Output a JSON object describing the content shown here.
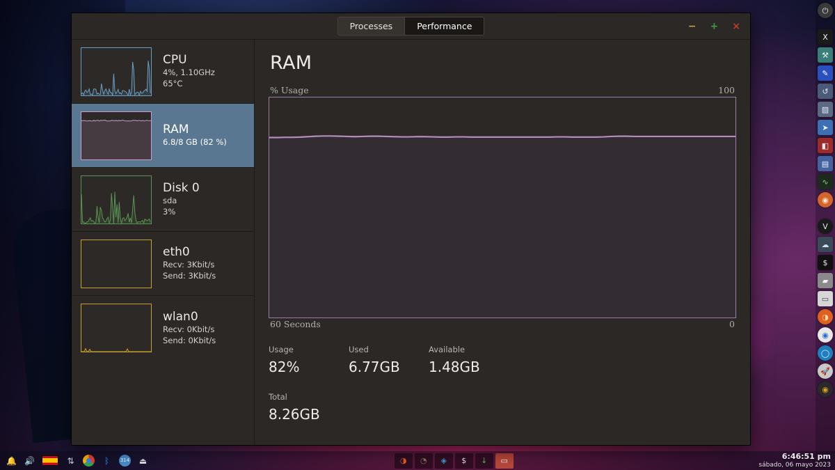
{
  "window": {
    "tabs": [
      {
        "label": "Processes",
        "active": false
      },
      {
        "label": "Performance",
        "active": true
      }
    ],
    "controls": {
      "minimize": "−",
      "maximize": "+",
      "close": "×"
    }
  },
  "sidebar": {
    "items": [
      {
        "id": "cpu",
        "title": "CPU",
        "lines": [
          "4%, 1.10GHz",
          "65°C"
        ],
        "color": "#6a9fc4",
        "selected": false,
        "graph_kind": "spiky-low"
      },
      {
        "id": "ram",
        "title": "RAM",
        "lines": [
          "6.8/8 GB (82 %)"
        ],
        "color": "#c79dd4",
        "selected": true,
        "graph_kind": "flat-high"
      },
      {
        "id": "disk0",
        "title": "Disk 0",
        "lines": [
          "sda",
          "3%"
        ],
        "color": "#5a9455",
        "selected": false,
        "graph_kind": "spiky-low"
      },
      {
        "id": "eth0",
        "title": "eth0",
        "lines": [
          "Recv: 3Kbit/s",
          "Send: 3Kbit/s"
        ],
        "color": "#c8a22a",
        "selected": false,
        "graph_kind": "empty"
      },
      {
        "id": "wlan0",
        "title": "wlan0",
        "lines": [
          "Recv: 0Kbit/s",
          "Send: 0Kbit/s"
        ],
        "color": "#c8a22a",
        "selected": false,
        "graph_kind": "near-zero"
      }
    ]
  },
  "main": {
    "title": "RAM",
    "axis": {
      "y_label": "% Usage",
      "y_max": "100",
      "y_min": "0",
      "x_label": "60 Seconds"
    },
    "stats": [
      {
        "label": "Usage",
        "value": "82%"
      },
      {
        "label": "Used",
        "value": "6.77GB"
      },
      {
        "label": "Available",
        "value": "1.48GB"
      }
    ],
    "total": {
      "label": "Total",
      "value": "8.26GB"
    },
    "accent_color": "#9b7ba8"
  },
  "chart_data": {
    "type": "area",
    "title": "RAM % Usage",
    "ylabel": "% Usage",
    "xlabel": "60 Seconds",
    "ylim": [
      0,
      100
    ],
    "xlim": [
      60,
      0
    ],
    "grid": false,
    "legend": false,
    "line_color": "#b48cc0",
    "fill_color": "#332c33",
    "series": [
      {
        "name": "RAM % Usage",
        "values": [
          81.8,
          81.8,
          81.9,
          81.9,
          82.0,
          82.2,
          82.4,
          82.5,
          82.5,
          82.4,
          82.3,
          82.2,
          82.3,
          82.4,
          82.4,
          82.3,
          82.2,
          82.1,
          82.1,
          82.2,
          82.2,
          82.1,
          82.0,
          82.0,
          82.1,
          82.1,
          82.0,
          82.0,
          82.0,
          82.0,
          82.0,
          82.0,
          82.0,
          82.0,
          82.0,
          82.0,
          82.0,
          82.1,
          82.1,
          82.0,
          82.0,
          82.0,
          82.0,
          82.1,
          82.3,
          82.4,
          82.4,
          82.3,
          82.3,
          82.3,
          82.3,
          82.3,
          82.3,
          82.3,
          82.3,
          82.3,
          82.3,
          82.3,
          82.3,
          82.3,
          82.3
        ]
      }
    ]
  },
  "taskbar": {
    "tray": [
      {
        "name": "notification-bell-icon",
        "glyph": "🔔"
      },
      {
        "name": "volume-icon",
        "glyph": "🔊"
      },
      {
        "name": "keyboard-layout-flag-icon",
        "glyph": ""
      },
      {
        "name": "network-activity-icon",
        "glyph": "⇅"
      },
      {
        "name": "chrome-icon",
        "glyph": ""
      },
      {
        "name": "bluetooth-icon",
        "glyph": ""
      },
      {
        "name": "updates-badge-icon",
        "glyph": "314"
      },
      {
        "name": "eject-icon",
        "glyph": "⏏"
      }
    ],
    "windows": [
      {
        "name": "task-firefox",
        "active": false
      },
      {
        "name": "task-gimp",
        "active": false
      },
      {
        "name": "task-water",
        "active": false
      },
      {
        "name": "task-terminal",
        "active": false
      },
      {
        "name": "task-updater",
        "active": false
      },
      {
        "name": "task-system-monitor",
        "active": true
      }
    ],
    "clock": {
      "time": "6:46:51 pm",
      "date": "sábado, 06 mayo 2023"
    }
  },
  "dock": {
    "items": [
      {
        "name": "power-icon",
        "glyph": "⏻",
        "bg": "#3a3a3a",
        "fg": "#e9e9e9"
      },
      {
        "name": "xterm-icon",
        "glyph": "X",
        "bg": "#1a1a1a",
        "fg": "#f2f2f2"
      },
      {
        "name": "tools-icon",
        "glyph": "⚒",
        "bg": "#3b7d78",
        "fg": "#dff4f2"
      },
      {
        "name": "editor-icon",
        "glyph": "✎",
        "bg": "#2a4fbf",
        "fg": "#fff"
      },
      {
        "name": "restore-icon",
        "glyph": "↺",
        "bg": "#4a5a78",
        "fg": "#dce6f5"
      },
      {
        "name": "image-viewer-icon",
        "glyph": "▨",
        "bg": "#5a6a84",
        "fg": "#e4ecf7"
      },
      {
        "name": "cursor-icon",
        "glyph": "➤",
        "bg": "#3d6fb5",
        "fg": "#eef4ff"
      },
      {
        "name": "libreoffice-icon",
        "glyph": "◧",
        "bg": "#9c2b2b",
        "fg": "#ffe8e8"
      },
      {
        "name": "presentation-icon",
        "glyph": "▤",
        "bg": "#45619e",
        "fg": "#e8f0ff"
      },
      {
        "name": "system-monitor-icon",
        "glyph": "∿",
        "bg": "#1e2a1e",
        "fg": "#7be27b"
      },
      {
        "name": "ubuntu-icon",
        "glyph": "◉",
        "bg": "#d4652a",
        "fg": "#ffe9d6"
      },
      {
        "name": "vivaldi-icon",
        "glyph": "V",
        "bg": "#1a1a1a",
        "fg": "#e8e8e8"
      },
      {
        "name": "cloud-icon",
        "glyph": "☁",
        "bg": "#3a4a58",
        "fg": "#cfe2ef"
      },
      {
        "name": "terminal-icon",
        "glyph": "$",
        "bg": "#111111",
        "fg": "#e6e6e6"
      },
      {
        "name": "folder-icon",
        "glyph": "▰",
        "bg": "#8a8a8a",
        "fg": "#f2f2f2"
      },
      {
        "name": "files-icon",
        "glyph": "▭",
        "bg": "#d6d6d6",
        "fg": "#444"
      },
      {
        "name": "firefox-icon",
        "glyph": "◑",
        "bg": "#e06020",
        "fg": "#ffd9a0"
      },
      {
        "name": "chrome-icon",
        "glyph": "◉",
        "bg": "#e8e8e8",
        "fg": "#2b6ad0"
      },
      {
        "name": "edge-icon",
        "glyph": "◯",
        "bg": "#1e7fc0",
        "fg": "#d8f2ff"
      },
      {
        "name": "launcher-icon",
        "glyph": "🚀",
        "bg": "#c8c8c8",
        "fg": "#333"
      },
      {
        "name": "discord-icon",
        "glyph": "◉",
        "bg": "#2a2a2a",
        "fg": "#d8a020"
      }
    ]
  }
}
